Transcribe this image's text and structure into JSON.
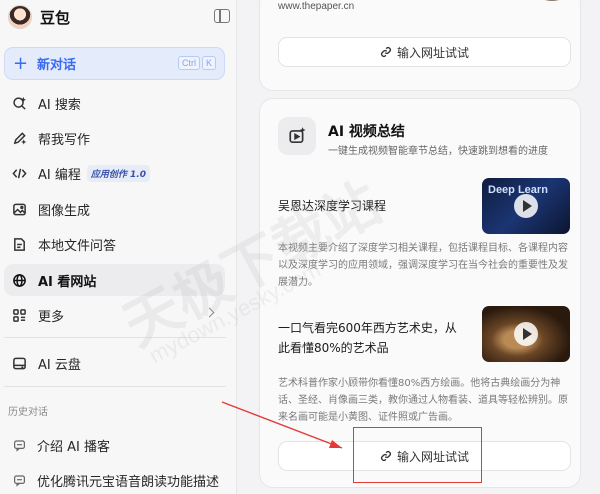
{
  "brand": {
    "name": "豆包"
  },
  "new_chat": {
    "label": "新对话",
    "shortcut": [
      "Ctrl",
      "K"
    ]
  },
  "nav": [
    {
      "label": "AI 搜索",
      "icon": "search-sparkle-icon"
    },
    {
      "label": "帮我写作",
      "icon": "pen-icon"
    },
    {
      "label": "AI 编程",
      "icon": "code-icon",
      "badge": "应用创作 1.0"
    },
    {
      "label": "图像生成",
      "icon": "image-icon"
    },
    {
      "label": "本地文件问答",
      "icon": "document-icon"
    },
    {
      "label": "AI 看网站",
      "icon": "globe-icon",
      "active": true
    },
    {
      "label": "更多",
      "icon": "grid-icon"
    }
  ],
  "cloud": {
    "label": "AI 云盘",
    "icon": "cloud-drive-icon"
  },
  "history": {
    "title": "历史对话",
    "items": [
      {
        "label": "介绍 AI 播客"
      },
      {
        "label": "优化腾讯元宝语音朗读功能描述"
      }
    ]
  },
  "top_card": {
    "url": "www.thepaper.cn",
    "button": "输入网址试试"
  },
  "video_card": {
    "title": "AI 视频总结",
    "desc": "一键生成视频智能章节总结，快速跳到想看的进度",
    "videos": [
      {
        "title": "吴恩达深度学习课程",
        "thumb_text": "Deep Learn",
        "desc": "本视频主要介绍了深度学习相关课程，包括课程目标、各课程内容以及深度学习的应用领域，强调深度学习在当今社会的重要性及发展潜力。"
      },
      {
        "title_line1": "一口气看完600年西方艺术史，从",
        "title_line2": "此看懂80%的艺术品",
        "desc": "艺术科普作家小顾带你看懂80%西方绘画。他将古典绘画分为神话、圣经、肖像画三类，教你通过人物看装、道具等轻松辨别。原来名画可能是小黄图、证件照或广告画。"
      }
    ],
    "button": "输入网址试试"
  },
  "watermark": {
    "text": "天极下载站",
    "url": "mydown.yesky.com"
  },
  "colors": {
    "accent": "#3a6af2",
    "highlight": "#e53935"
  }
}
